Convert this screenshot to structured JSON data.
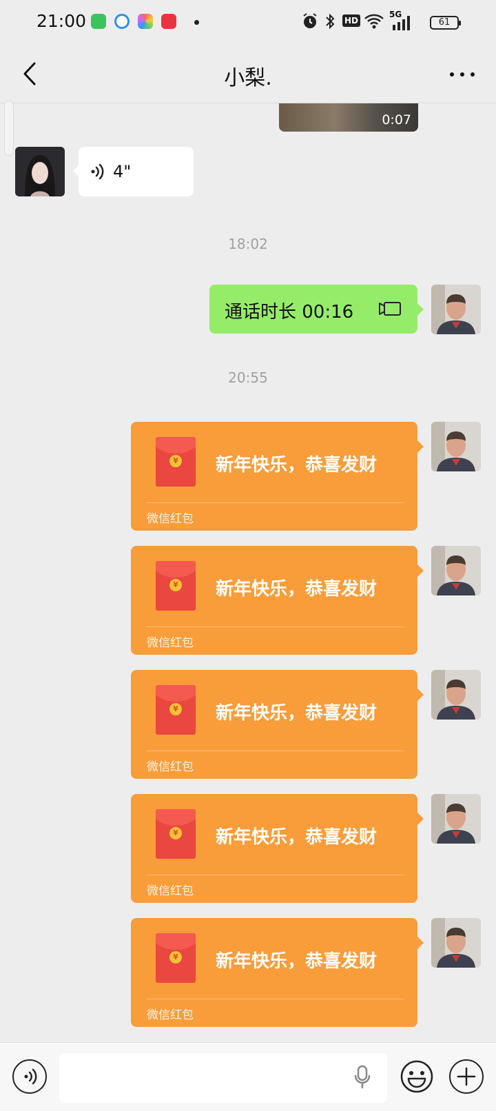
{
  "status": {
    "time": "21:00",
    "battery": "61",
    "network": "5G",
    "hd": "HD"
  },
  "header": {
    "title": "小梨."
  },
  "messages": {
    "video": {
      "duration": "0:07"
    },
    "voice": {
      "length": "4\""
    },
    "time1": "18:02",
    "call": {
      "text": "通话时长 00:16"
    },
    "time2": "20:55",
    "red_packets": [
      {
        "greeting": "新年快乐，恭喜发财",
        "footer": "微信红包"
      },
      {
        "greeting": "新年快乐，恭喜发财",
        "footer": "微信红包"
      },
      {
        "greeting": "新年快乐，恭喜发财",
        "footer": "微信红包"
      },
      {
        "greeting": "新年快乐，恭喜发财",
        "footer": "微信红包"
      },
      {
        "greeting": "新年快乐，恭喜发财",
        "footer": "微信红包"
      }
    ],
    "coin_symbol": "¥"
  },
  "input": {
    "value": "",
    "placeholder": ""
  },
  "colors": {
    "background": "#ededed",
    "my_bubble": "#95ec69",
    "red_packet": "#f89d3a"
  }
}
